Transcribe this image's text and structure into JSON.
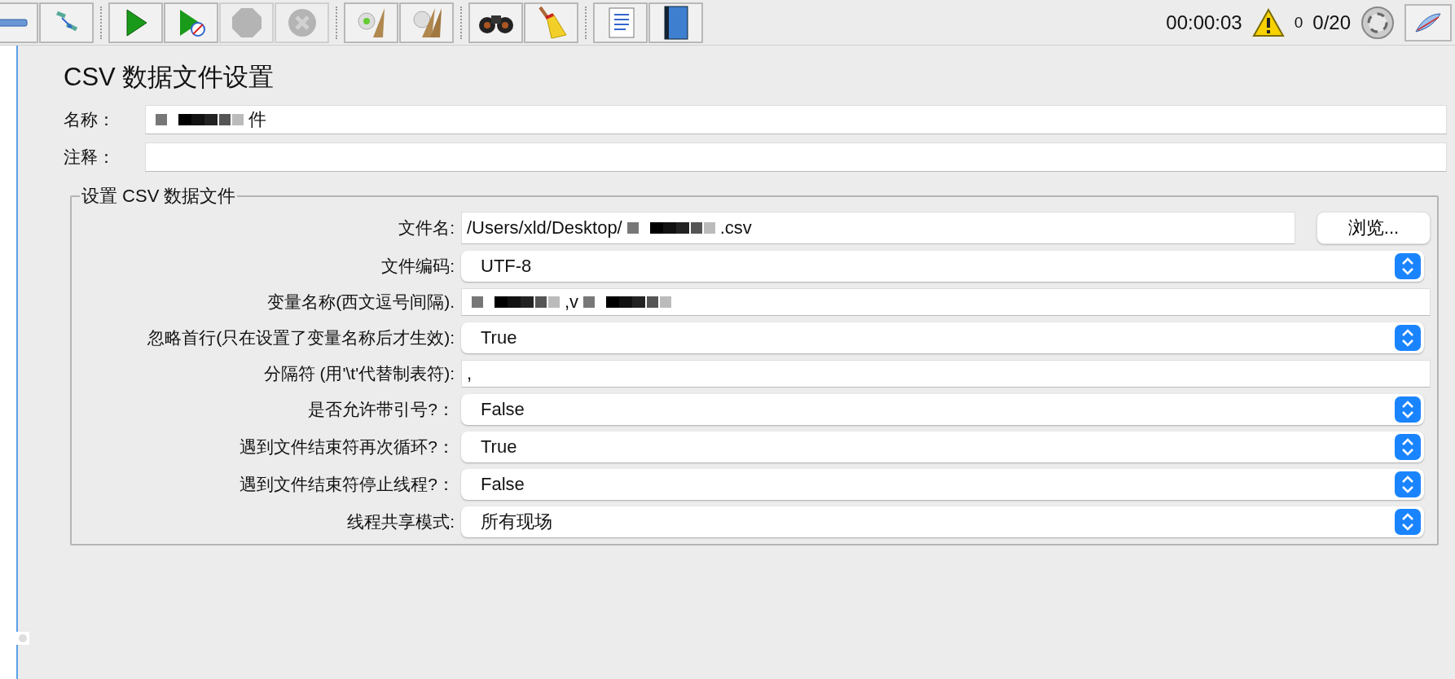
{
  "toolbar": {
    "groups": [
      {
        "buttons": [
          {
            "kind": "collapse",
            "disabled": false
          },
          {
            "kind": "toggle",
            "disabled": false
          }
        ]
      },
      {
        "buttons": [
          {
            "kind": "start",
            "disabled": false
          },
          {
            "kind": "start-no-pause",
            "disabled": false
          },
          {
            "kind": "stop",
            "disabled": true
          },
          {
            "kind": "shutdown",
            "disabled": true
          }
        ]
      },
      {
        "buttons": [
          {
            "kind": "clear",
            "disabled": false
          },
          {
            "kind": "clear-all",
            "disabled": false
          }
        ]
      },
      {
        "buttons": [
          {
            "kind": "search",
            "disabled": false
          },
          {
            "kind": "reset-search",
            "disabled": false
          }
        ]
      },
      {
        "buttons": [
          {
            "kind": "function-helper",
            "disabled": false
          },
          {
            "kind": "help",
            "disabled": false
          }
        ]
      }
    ],
    "timer": "00:00:03",
    "warnings": "0",
    "threads": "0/20"
  },
  "panel": {
    "title": "CSV 数据文件设置",
    "name": {
      "label": "名称：",
      "value": [
        {
          "kind": "redacted"
        },
        {
          "kind": "text",
          "text": "件"
        }
      ]
    },
    "comment": {
      "label": "注释："
    },
    "group": {
      "legend": "设置 CSV 数据文件",
      "rows": [
        {
          "kind": "file",
          "label": "文件名:",
          "value": [
            {
              "kind": "text",
              "text": "/Users/xld/Desktop/"
            },
            {
              "kind": "redacted"
            },
            {
              "kind": "text",
              "text": ".csv"
            }
          ],
          "button": "浏览..."
        },
        {
          "kind": "select",
          "label": "文件编码:",
          "value": "UTF-8"
        },
        {
          "kind": "text",
          "label": "变量名称(西文逗号间隔).",
          "value": [
            {
              "kind": "redacted"
            },
            {
              "kind": "text",
              "text": ",v"
            },
            {
              "kind": "redacted"
            }
          ]
        },
        {
          "kind": "select",
          "label": "忽略首行(只在设置了变量名称后才生效):",
          "value": "True"
        },
        {
          "kind": "text",
          "label": "分隔符 (用'\\t'代替制表符):",
          "value": [
            {
              "kind": "text",
              "text": ","
            }
          ]
        },
        {
          "kind": "select",
          "label": "是否允许带引号?：",
          "value": "False"
        },
        {
          "kind": "select",
          "label": "遇到文件结束符再次循环?：",
          "value": "True"
        },
        {
          "kind": "select",
          "label": "遇到文件结束符停止线程?：",
          "value": "False"
        },
        {
          "kind": "select",
          "label": "线程共享模式:",
          "value": "所有现场"
        }
      ]
    }
  }
}
